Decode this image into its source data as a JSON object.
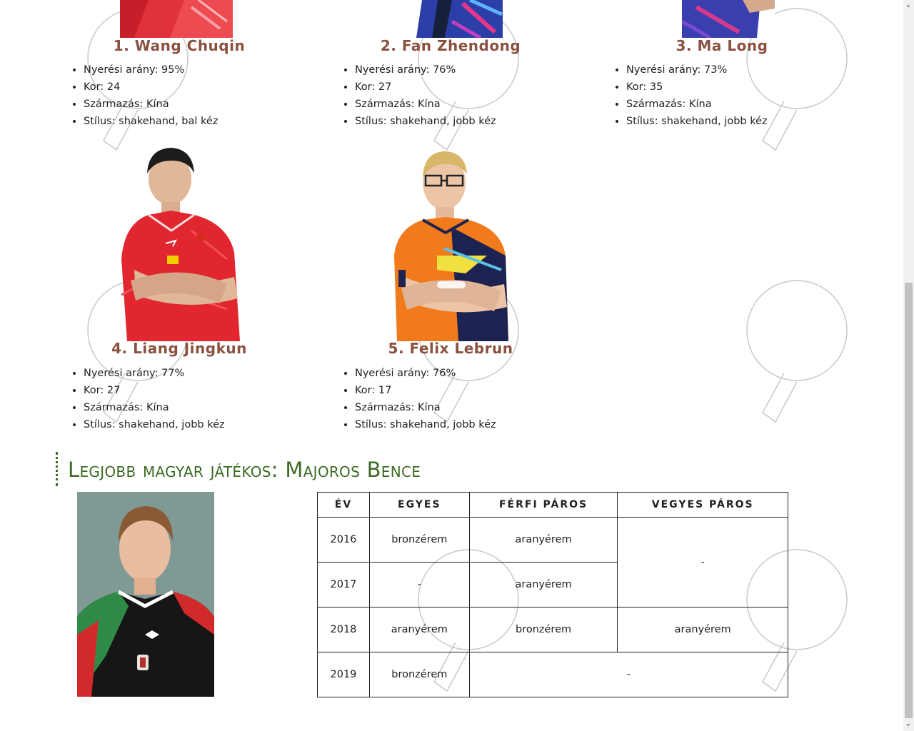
{
  "players": [
    {
      "rank_name": "1. Wang Chuqin",
      "stats": [
        "Nyerési arány: 95%",
        "Kor: 24",
        "Származás: Kína",
        "Stílus: shakehand, bal kéz"
      ]
    },
    {
      "rank_name": "2. Fan Zhendong",
      "stats": [
        "Nyerési arány: 76%",
        "Kor: 27",
        "Származás: Kína",
        "Stílus: shakehand, jobb kéz"
      ]
    },
    {
      "rank_name": "3. Ma Long",
      "stats": [
        "Nyerési arány: 73%",
        "Kor: 35",
        "Származás: Kína",
        "Stílus: shakehand, jobb kéz"
      ]
    },
    {
      "rank_name": "4. Liang Jingkun",
      "stats": [
        "Nyerési arány: 77%",
        "Kor: 27",
        "Származás: Kína",
        "Stílus: shakehand, jobb kéz"
      ]
    },
    {
      "rank_name": "5. Felix Lebrun",
      "stats": [
        "Nyerési arány: 76%",
        "Kor: 17",
        "Származás: Kína",
        "Stílus: shakehand, jobb kéz"
      ]
    }
  ],
  "hungarian_section": {
    "heading": "Legjobb magyar játékos: Majoros Bence",
    "table": {
      "headers": [
        "ÉV",
        "EGYES",
        "FÉRFI PÁROS",
        "VEGYES PÁROS"
      ],
      "rows": [
        {
          "year": "2016",
          "singles": "bronzérem",
          "mens_doubles": "aranyérem",
          "mixed_doubles": "-"
        },
        {
          "year": "2017",
          "singles": "-",
          "mens_doubles": "aranyérem"
        },
        {
          "year": "2018",
          "singles": "aranyérem",
          "mens_doubles": "bronzérem",
          "mixed_doubles": "aranyérem"
        },
        {
          "year": "2019",
          "singles": "bronzérem",
          "doubles_merged": "-"
        }
      ]
    }
  },
  "colors": {
    "player_name": "#8a5040",
    "section_heading": "#3f6b25",
    "table_border": "#222222"
  },
  "icons": {
    "watermark": "table-tennis-paddle-icon"
  }
}
